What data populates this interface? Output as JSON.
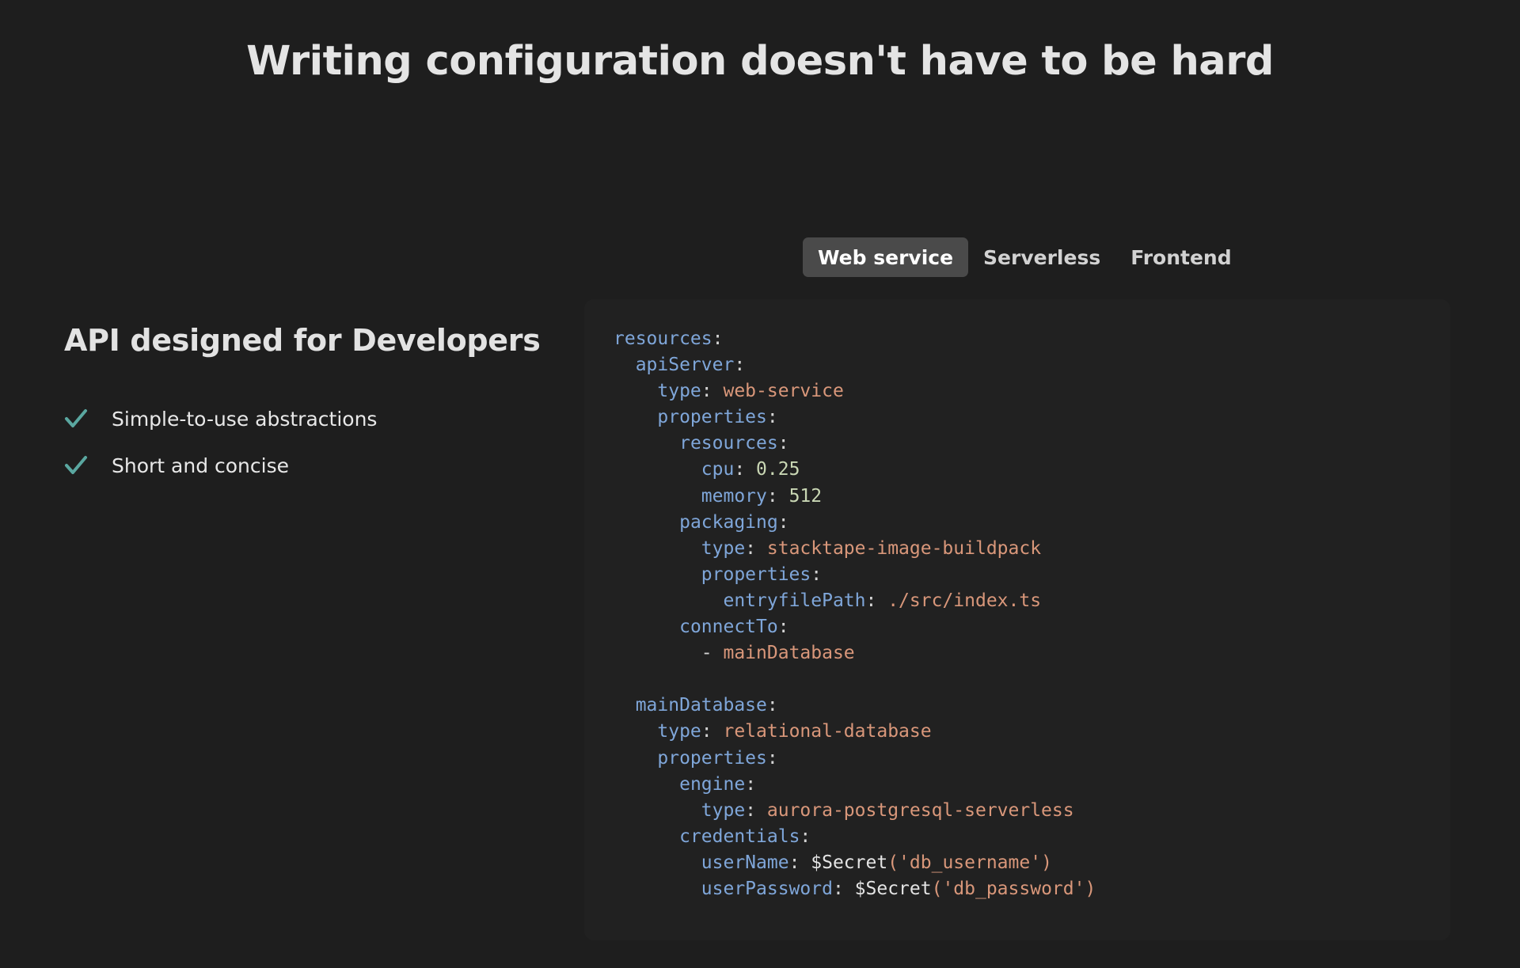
{
  "headline": "Writing configuration doesn't have to be hard",
  "tabs": [
    {
      "label": "Web service",
      "active": true
    },
    {
      "label": "Serverless",
      "active": false
    },
    {
      "label": "Frontend",
      "active": false
    }
  ],
  "section": {
    "heading": "API designed for Developers",
    "features": [
      "Simple-to-use abstractions",
      "Short and concise"
    ]
  },
  "colors": {
    "background": "#1e1e1e",
    "panel": "#212121",
    "active_tab": "#4a4a4a",
    "check_icon": "#5aa7a0",
    "code_key": "#7fa6d9",
    "code_string": "#d9977a",
    "code_number": "#c9d7b4"
  },
  "code_lines": [
    [
      {
        "t": "resources",
        "c": "k"
      },
      {
        "t": ":",
        "c": "p"
      }
    ],
    [
      {
        "t": "  "
      },
      {
        "t": "apiServer",
        "c": "k"
      },
      {
        "t": ":",
        "c": "p"
      }
    ],
    [
      {
        "t": "    "
      },
      {
        "t": "type",
        "c": "k"
      },
      {
        "t": ": ",
        "c": "p"
      },
      {
        "t": "web-service",
        "c": "s"
      }
    ],
    [
      {
        "t": "    "
      },
      {
        "t": "properties",
        "c": "k"
      },
      {
        "t": ":",
        "c": "p"
      }
    ],
    [
      {
        "t": "      "
      },
      {
        "t": "resources",
        "c": "k"
      },
      {
        "t": ":",
        "c": "p"
      }
    ],
    [
      {
        "t": "        "
      },
      {
        "t": "cpu",
        "c": "k"
      },
      {
        "t": ": ",
        "c": "p"
      },
      {
        "t": "0.25",
        "c": "n"
      }
    ],
    [
      {
        "t": "        "
      },
      {
        "t": "memory",
        "c": "k"
      },
      {
        "t": ": ",
        "c": "p"
      },
      {
        "t": "512",
        "c": "n"
      }
    ],
    [
      {
        "t": "      "
      },
      {
        "t": "packaging",
        "c": "k"
      },
      {
        "t": ":",
        "c": "p"
      }
    ],
    [
      {
        "t": "        "
      },
      {
        "t": "type",
        "c": "k"
      },
      {
        "t": ": ",
        "c": "p"
      },
      {
        "t": "stacktape-image-buildpack",
        "c": "s"
      }
    ],
    [
      {
        "t": "        "
      },
      {
        "t": "properties",
        "c": "k"
      },
      {
        "t": ":",
        "c": "p"
      }
    ],
    [
      {
        "t": "          "
      },
      {
        "t": "entryfilePath",
        "c": "k"
      },
      {
        "t": ": ",
        "c": "p"
      },
      {
        "t": "./src/index.ts",
        "c": "s"
      }
    ],
    [
      {
        "t": "      "
      },
      {
        "t": "connectTo",
        "c": "k"
      },
      {
        "t": ":",
        "c": "p"
      }
    ],
    [
      {
        "t": "        "
      },
      {
        "t": "- ",
        "c": "p"
      },
      {
        "t": "mainDatabase",
        "c": "s"
      }
    ],
    [],
    [
      {
        "t": "  "
      },
      {
        "t": "mainDatabase",
        "c": "k"
      },
      {
        "t": ":",
        "c": "p"
      }
    ],
    [
      {
        "t": "    "
      },
      {
        "t": "type",
        "c": "k"
      },
      {
        "t": ": ",
        "c": "p"
      },
      {
        "t": "relational-database",
        "c": "s"
      }
    ],
    [
      {
        "t": "    "
      },
      {
        "t": "properties",
        "c": "k"
      },
      {
        "t": ":",
        "c": "p"
      }
    ],
    [
      {
        "t": "      "
      },
      {
        "t": "engine",
        "c": "k"
      },
      {
        "t": ":",
        "c": "p"
      }
    ],
    [
      {
        "t": "        "
      },
      {
        "t": "type",
        "c": "k"
      },
      {
        "t": ": ",
        "c": "p"
      },
      {
        "t": "aurora-postgresql-serverless",
        "c": "s"
      }
    ],
    [
      {
        "t": "      "
      },
      {
        "t": "credentials",
        "c": "k"
      },
      {
        "t": ":",
        "c": "p"
      }
    ],
    [
      {
        "t": "        "
      },
      {
        "t": "userName",
        "c": "k"
      },
      {
        "t": ": ",
        "c": "p"
      },
      {
        "t": "$Secret",
        "c": "f"
      },
      {
        "t": "('db_username')",
        "c": "s"
      }
    ],
    [
      {
        "t": "        "
      },
      {
        "t": "userPassword",
        "c": "k"
      },
      {
        "t": ": ",
        "c": "p"
      },
      {
        "t": "$Secret",
        "c": "f"
      },
      {
        "t": "('db_password')",
        "c": "s"
      }
    ]
  ]
}
